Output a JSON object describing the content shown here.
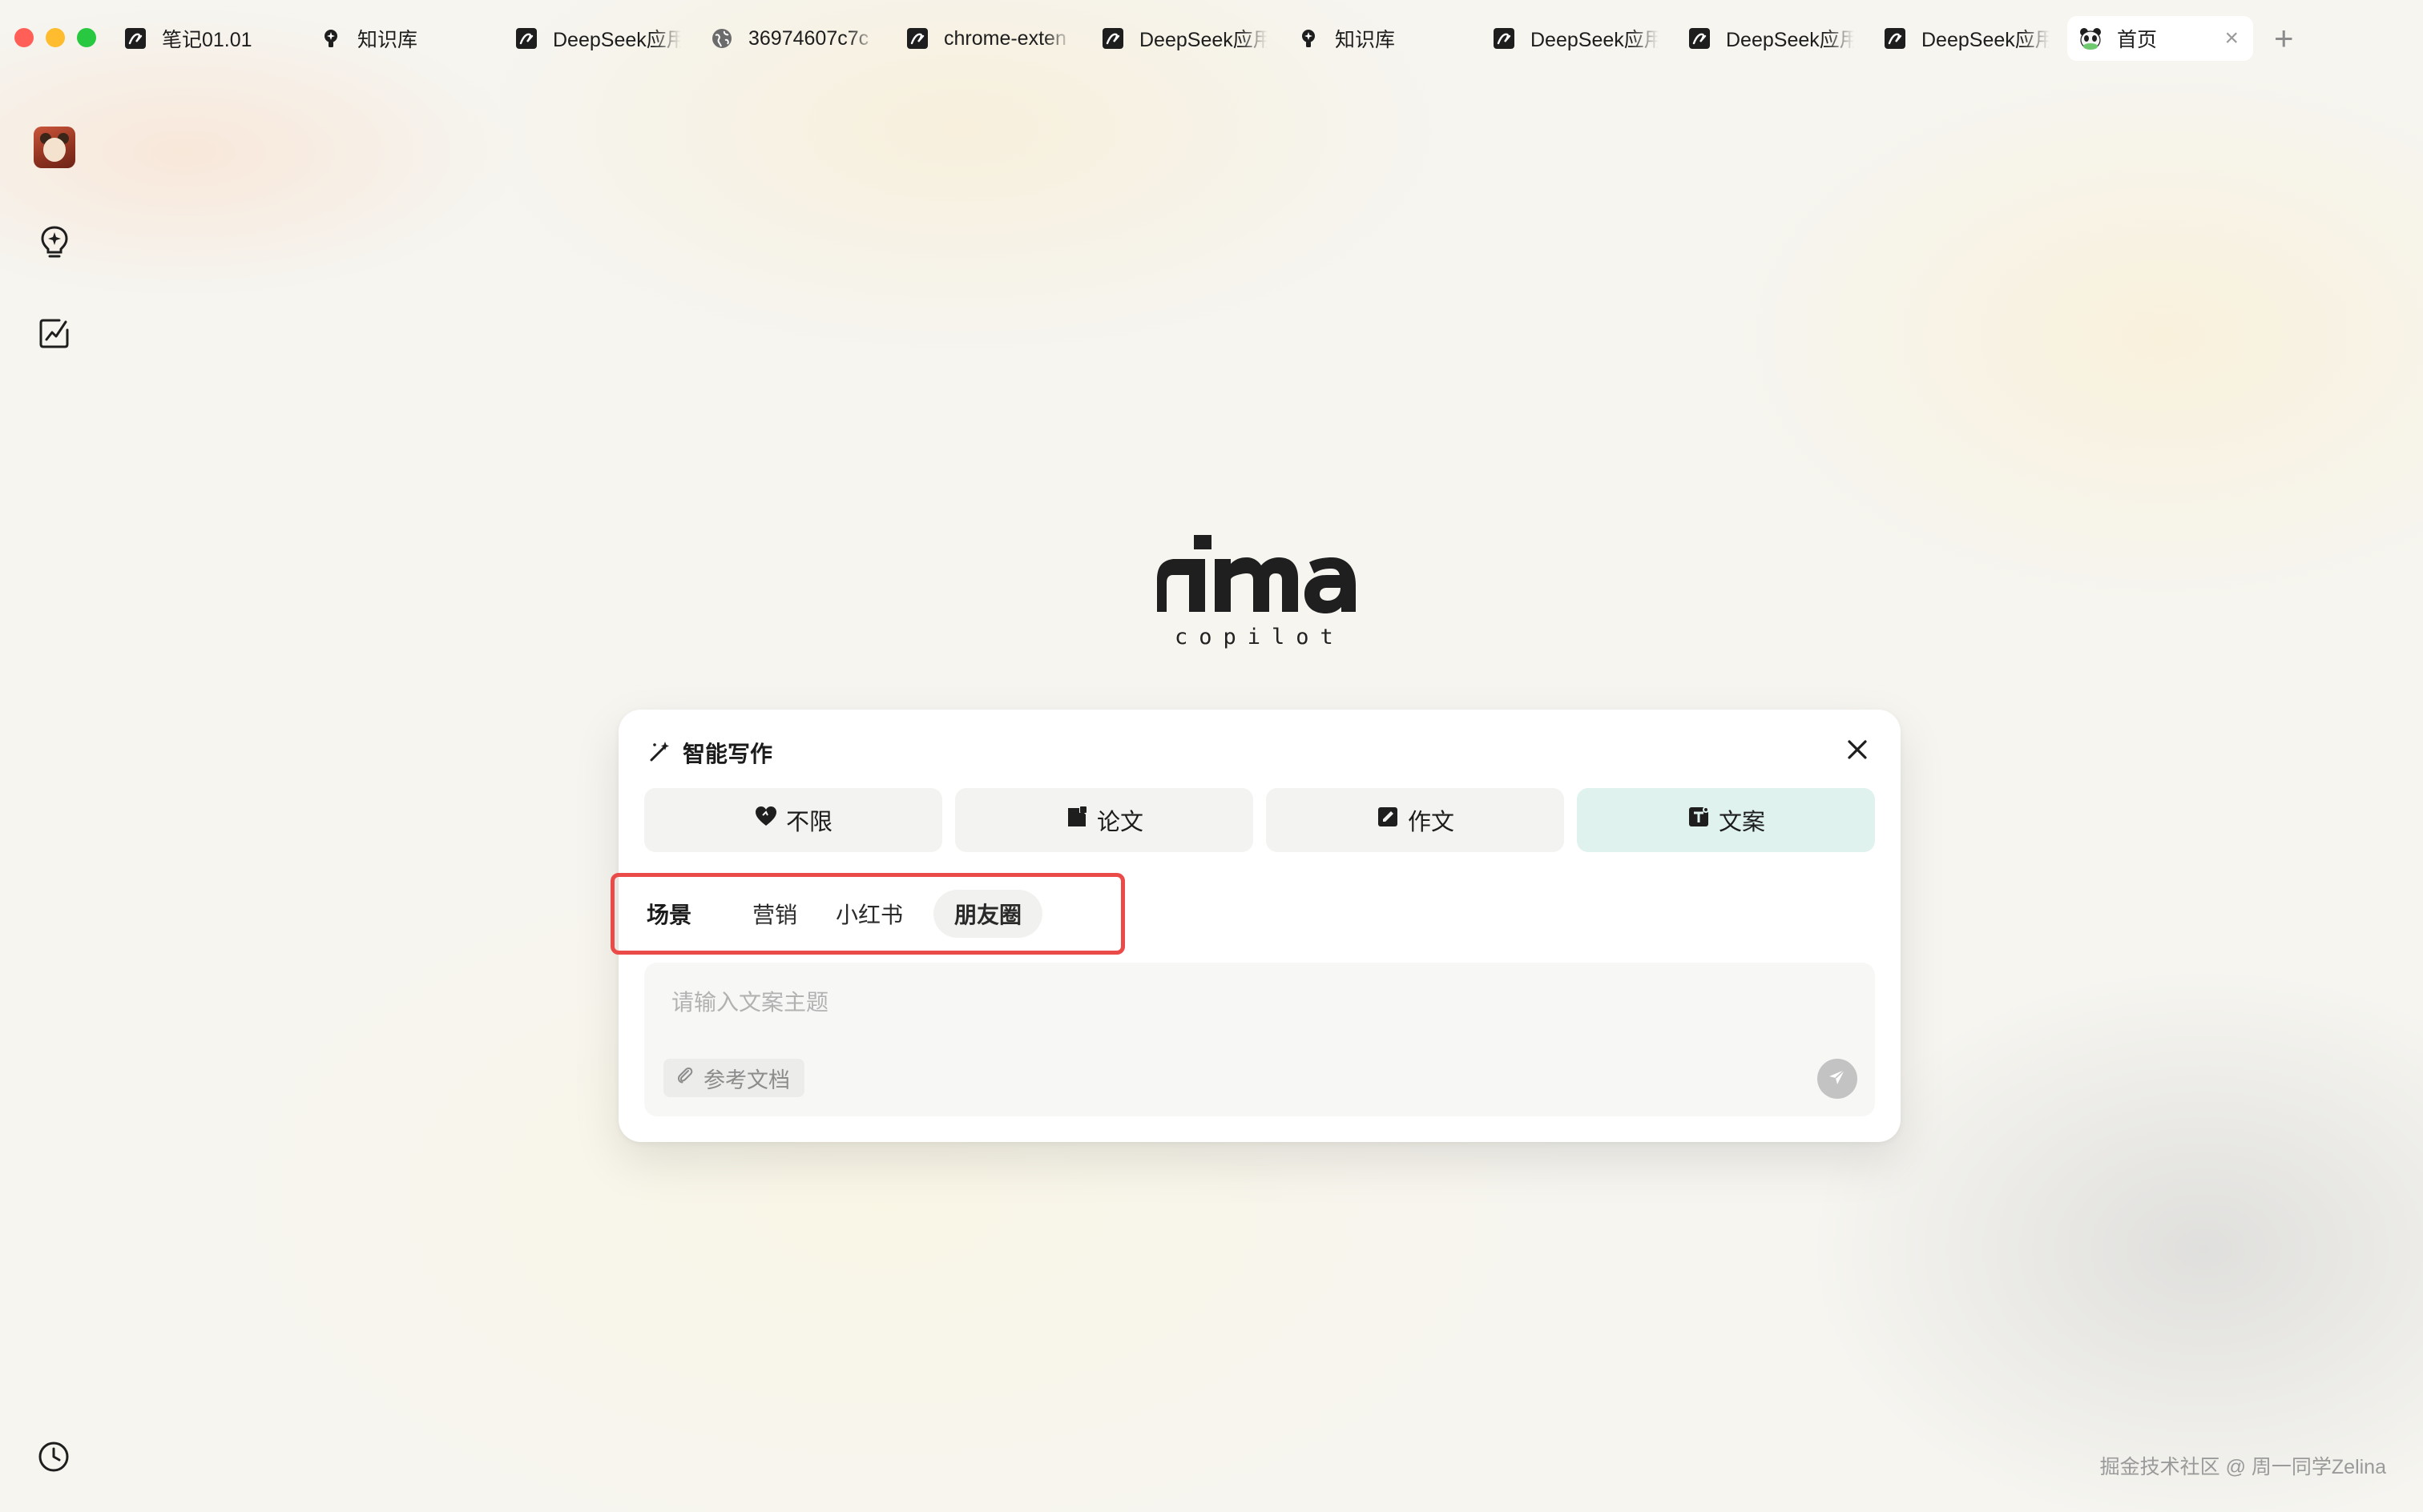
{
  "tabs": [
    {
      "label": "笔记01.01",
      "icon": "note-icon"
    },
    {
      "label": "知识库",
      "icon": "lightbulb-icon"
    },
    {
      "label": "DeepSeek应用",
      "icon": "note-icon"
    },
    {
      "label": "36974607c7c",
      "icon": "globe-icon"
    },
    {
      "label": "chrome-exten",
      "icon": "note-icon"
    },
    {
      "label": "DeepSeek应用",
      "icon": "note-icon"
    },
    {
      "label": "知识库",
      "icon": "lightbulb-icon"
    },
    {
      "label": "DeepSeek应用",
      "icon": "note-icon"
    },
    {
      "label": "DeepSeek应用",
      "icon": "note-icon"
    },
    {
      "label": "DeepSeek应用",
      "icon": "note-icon"
    },
    {
      "label": "首页",
      "icon": "panda-icon",
      "active": true
    }
  ],
  "logo": {
    "wordmark": "ima",
    "subtitle": "copilot"
  },
  "card": {
    "title": "智能写作",
    "types": [
      {
        "label": "不限",
        "icon": "heart-icon"
      },
      {
        "label": "论文",
        "icon": "document-icon"
      },
      {
        "label": "作文",
        "icon": "pen-square-icon"
      },
      {
        "label": "文案",
        "icon": "text-square-icon",
        "selected": true
      }
    ],
    "scene_label": "场景",
    "scenes": [
      "营销",
      "小红书",
      "朋友圈"
    ],
    "active_scene": "朋友圈",
    "input_placeholder": "请输入文案主题",
    "reference_label": "参考文档"
  },
  "watermark": "掘金技术社区 @ 周一同学Zelina",
  "colors": {
    "accent_selected": "#dff2ee",
    "highlight_border": "#ea4a48",
    "background": "#f6f5f0"
  }
}
